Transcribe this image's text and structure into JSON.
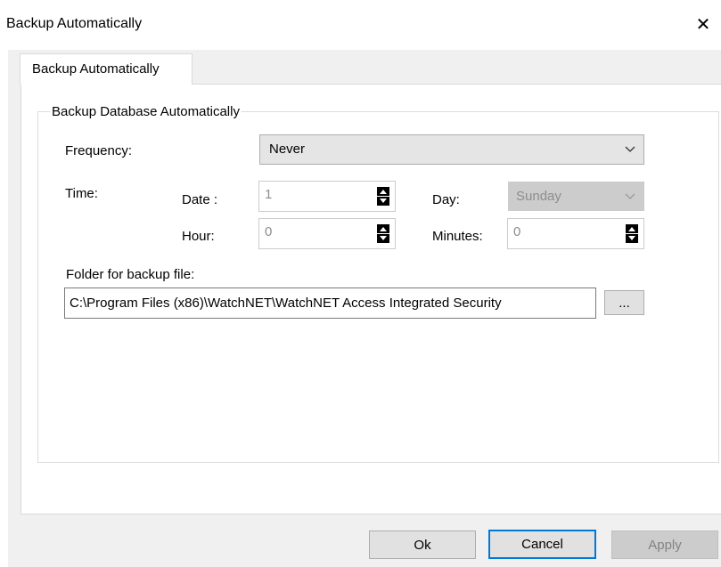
{
  "window": {
    "title": "Backup Automatically",
    "close_glyph": "✕"
  },
  "tabs": [
    {
      "label": "Backup Automatically"
    }
  ],
  "group": {
    "legend": "Backup Database Automatically"
  },
  "frequency": {
    "label": "Frequency:",
    "value": "Never"
  },
  "time": {
    "label": "Time:",
    "date": {
      "label": "Date :",
      "value": "1"
    },
    "hour": {
      "label": "Hour:",
      "value": "0"
    },
    "day": {
      "label": "Day:",
      "value": "Sunday"
    },
    "minutes": {
      "label": "Minutes:",
      "value": "0"
    }
  },
  "folder": {
    "label": "Folder for backup file:",
    "value": "C:\\Program Files (x86)\\WatchNET\\WatchNET Access Integrated Security",
    "browse_label": "..."
  },
  "buttons": {
    "ok": "Ok",
    "cancel": "Cancel",
    "apply": "Apply"
  },
  "icons": {
    "close": "close-icon",
    "dropdown": "chevron-down-icon",
    "spinner": "spinner-arrows-icon"
  },
  "colors": {
    "accent": "#0078d7",
    "dialog_bg": "#f0f0f0",
    "disabled_text": "#8d8d8d"
  }
}
